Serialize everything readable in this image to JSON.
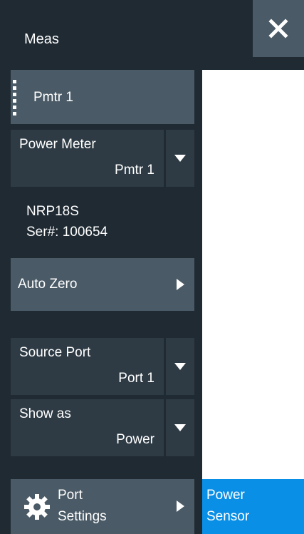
{
  "header": {
    "title": "Meas",
    "close_icon": "close-icon"
  },
  "pmtr_button": {
    "label": "Pmtr 1"
  },
  "power_meter": {
    "label": "Power Meter",
    "value": "Pmtr 1"
  },
  "device_info": {
    "model": "NRP18S",
    "serial": "Ser#: 100654"
  },
  "auto_zero": {
    "label": "Auto Zero"
  },
  "source_port": {
    "label": "Source Port",
    "value": "Port 1"
  },
  "show_as": {
    "label": "Show as",
    "value": "Power"
  },
  "port_settings": {
    "line1": "Port",
    "line2": "Settings",
    "icon": "gear-icon"
  },
  "power_sensor_tab": {
    "line1": "Power",
    "line2": "Sensor"
  },
  "colors": {
    "panel_bg": "#1f2a33",
    "button_bg": "#4a5a66",
    "combo_bg": "#2e3b45",
    "accent": "#0a8fe6"
  }
}
